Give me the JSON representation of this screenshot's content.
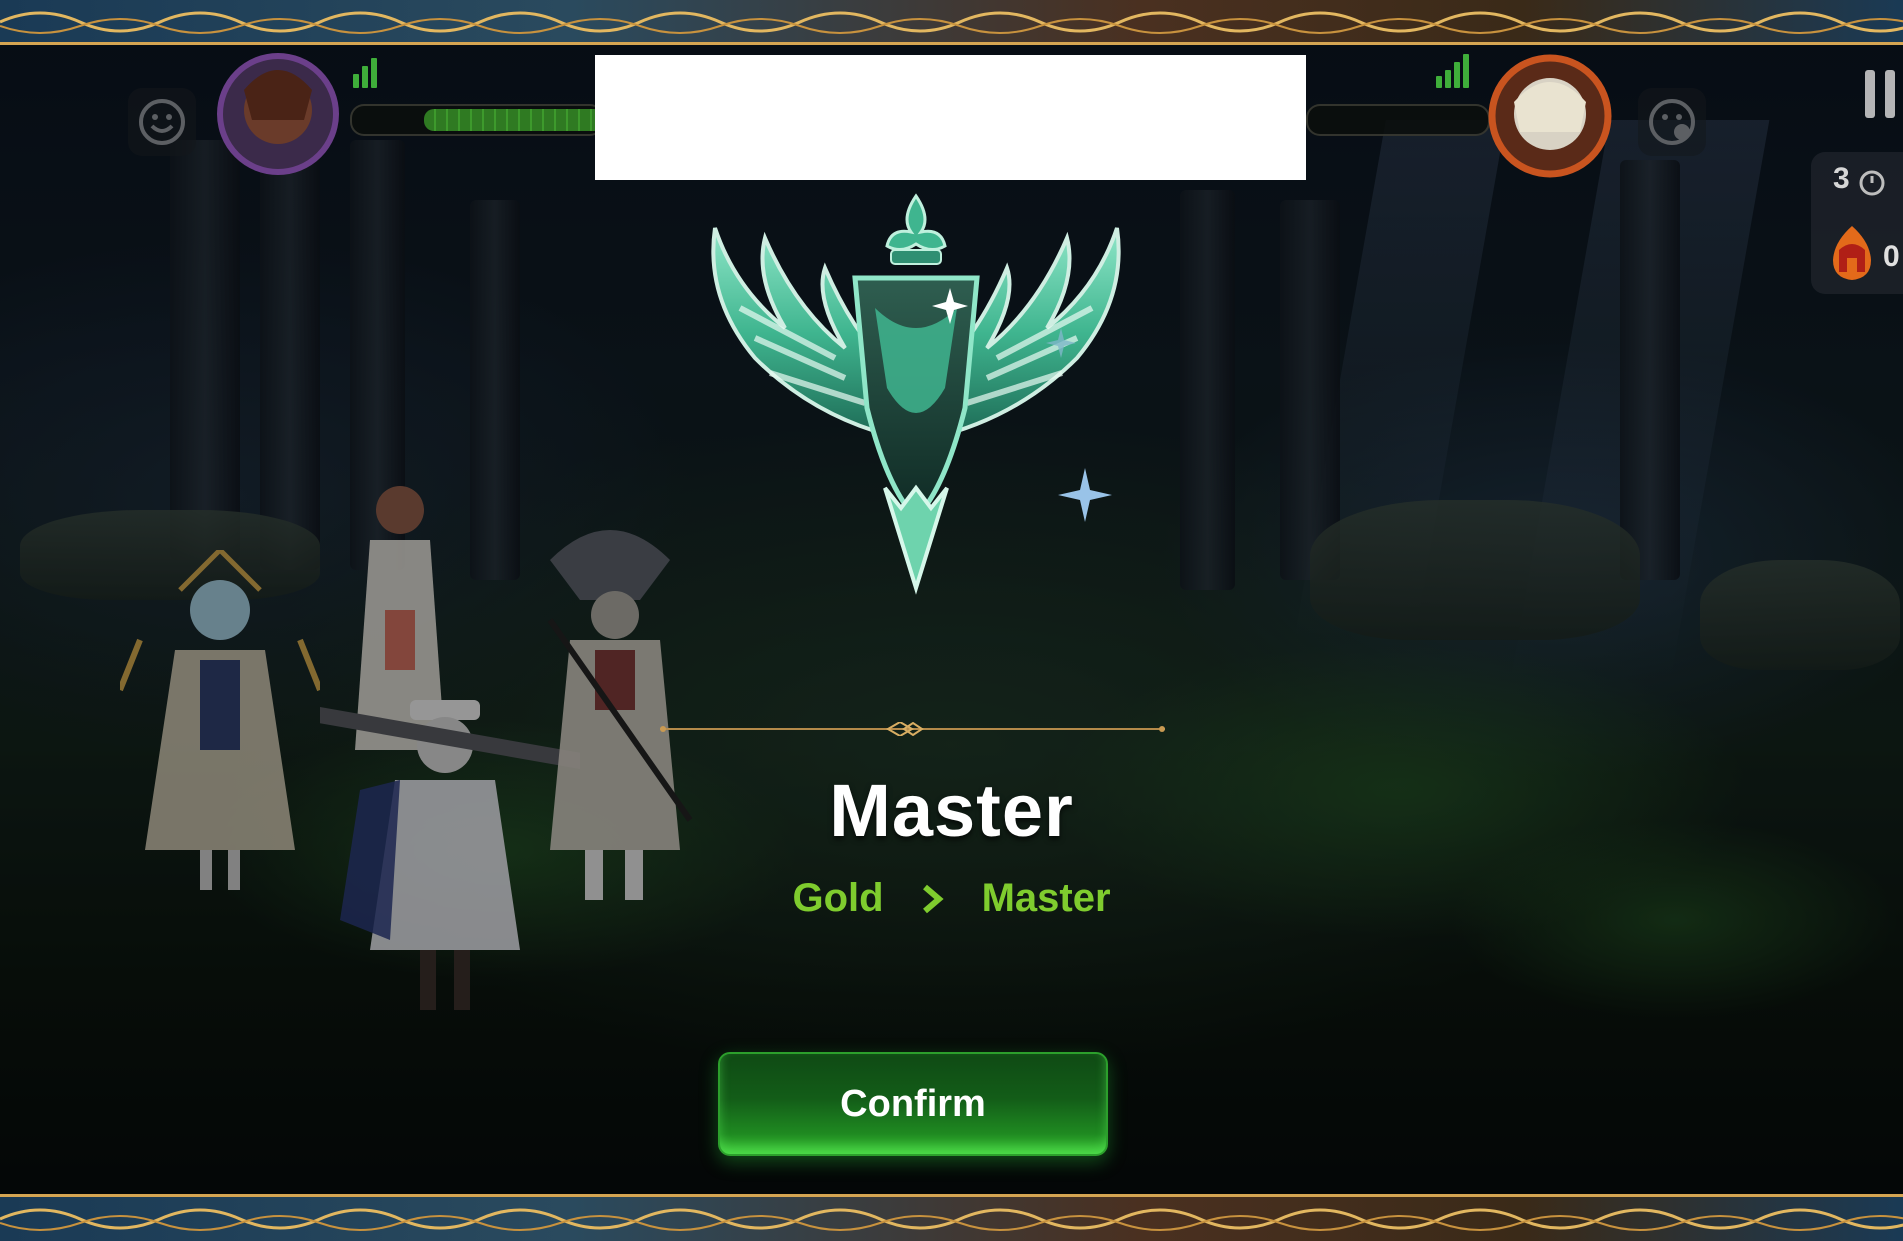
{
  "screen": "rank-up-result",
  "hud": {
    "left_player": {
      "emote_icon": "smile-face-icon",
      "portrait": "player-portrait",
      "hp_percent": 0.7
    },
    "right_player": {
      "emote_icon": "emote-face-icon",
      "portrait": "opponent-portrait"
    },
    "side_counter": {
      "value": "3",
      "icon": "timer-icon"
    },
    "side_bonus": {
      "value": "0",
      "icon": "spartan-helmet-fire-icon"
    }
  },
  "result": {
    "rank_title": "Master",
    "from_rank": "Gold",
    "to_rank": "Master",
    "emblem": "winged-master-emblem",
    "confirm_label": "Confirm"
  },
  "colors": {
    "accent_green": "#7fcc2e",
    "button_green": "#1f8a21",
    "border_gold": "#d5a552",
    "emblem_teal": "#3fb58f"
  }
}
